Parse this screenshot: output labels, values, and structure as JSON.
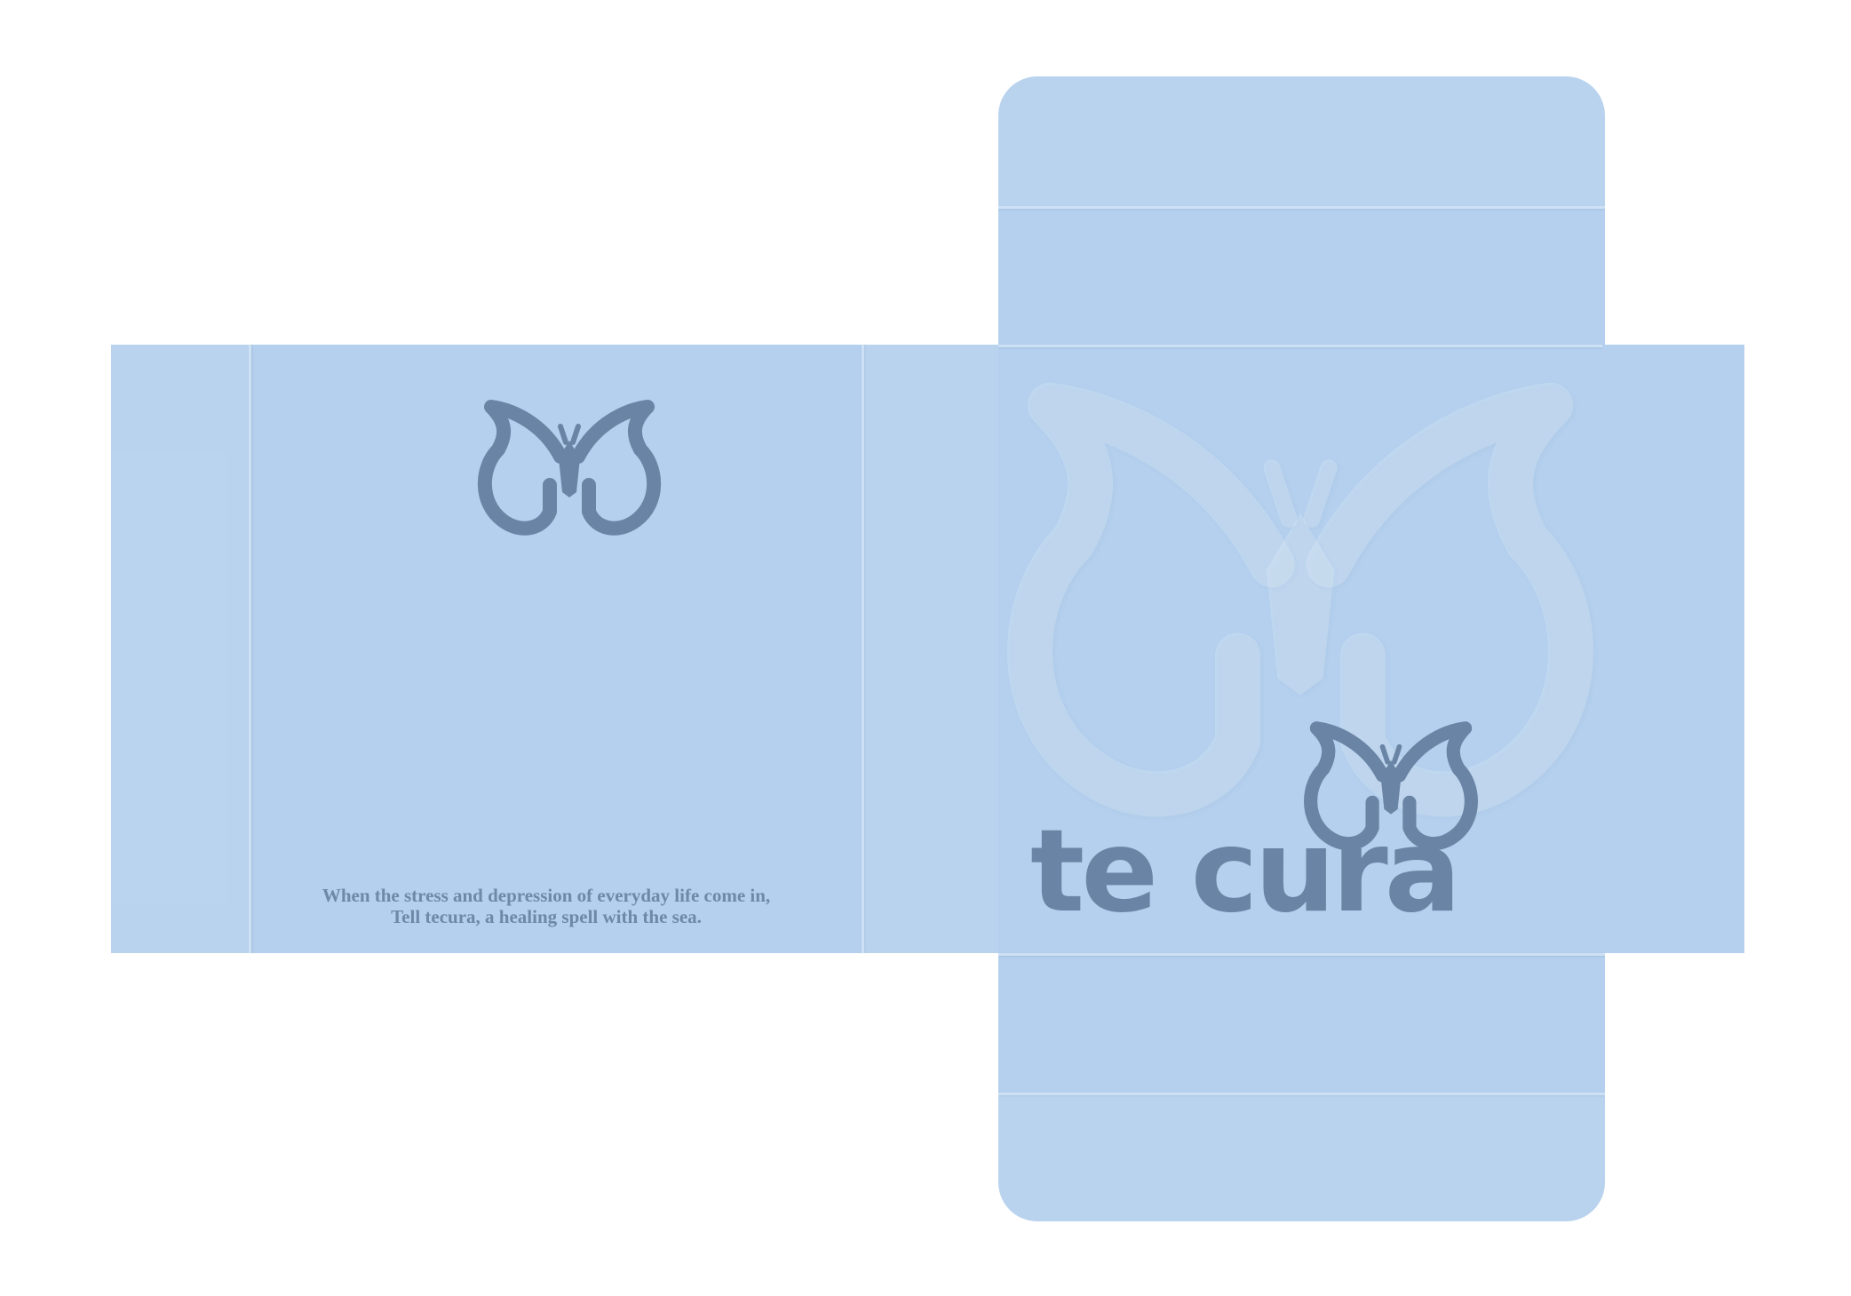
{
  "brand": {
    "wordmark": "te cura",
    "logo_icon": "butterfly-icon",
    "colors": {
      "panel": "#b4d0ee",
      "ink": "#6984a4",
      "background": "#ffffff"
    }
  },
  "tagline": {
    "line1": "When the stress and depression of everyday life come in,",
    "line2": "Tell tecura, a healing spell with the sea."
  }
}
